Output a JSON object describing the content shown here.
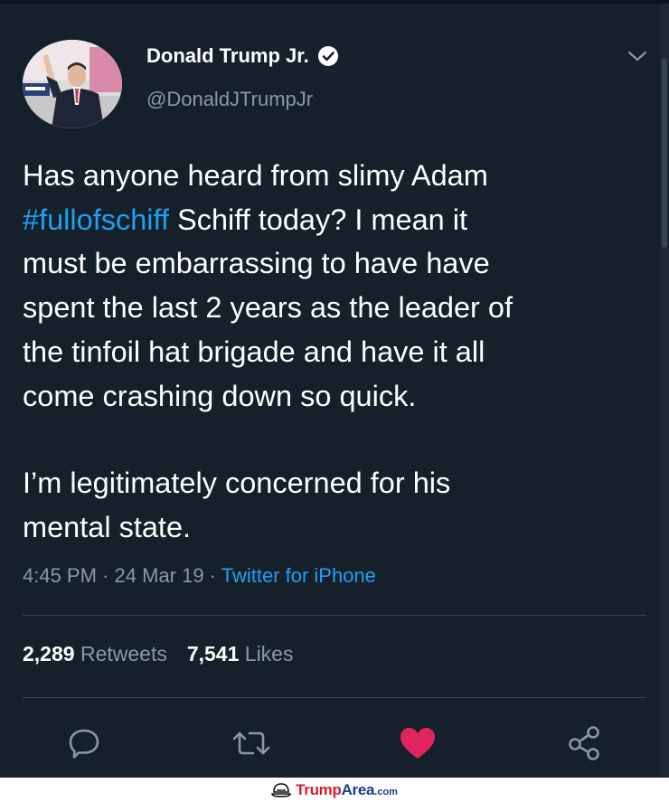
{
  "colors": {
    "background": "#15202b",
    "text": "#ffffff",
    "secondary_text": "#8899a6",
    "accent": "#1da1f2",
    "divider": "#38444d",
    "like_active": "#e0245e"
  },
  "tweet": {
    "author": {
      "name": "Donald Trump Jr.",
      "handle": "@DonaldJTrumpJr",
      "verified": true
    },
    "text": {
      "para1_start": "Has anyone heard from slimy Adam\n",
      "hashtag": "#fullofschiff",
      "para1_rest": " Schiff today? I mean it\nmust be embarrassing to have have\nspent the last 2 years as the leader of\nthe tinfoil hat brigade and have it all\ncome crashing down so quick.",
      "para2": "I’m legitimately concerned for his\nmental state."
    },
    "meta": {
      "time": "4:45 PM",
      "separator": " · ",
      "date": "24 Mar 19",
      "source": "Twitter for iPhone"
    },
    "stats": {
      "retweets_count": "2,289",
      "retweets_label": "Retweets",
      "likes_count": "7,541",
      "likes_label": "Likes"
    },
    "actions": [
      {
        "icon": "reply-icon"
      },
      {
        "icon": "retweet-icon"
      },
      {
        "icon": "like-heart-icon",
        "active": true
      },
      {
        "icon": "share-icon"
      }
    ]
  },
  "watermark": {
    "part1": "Trump",
    "part2": "Area",
    "part3": ".com"
  }
}
